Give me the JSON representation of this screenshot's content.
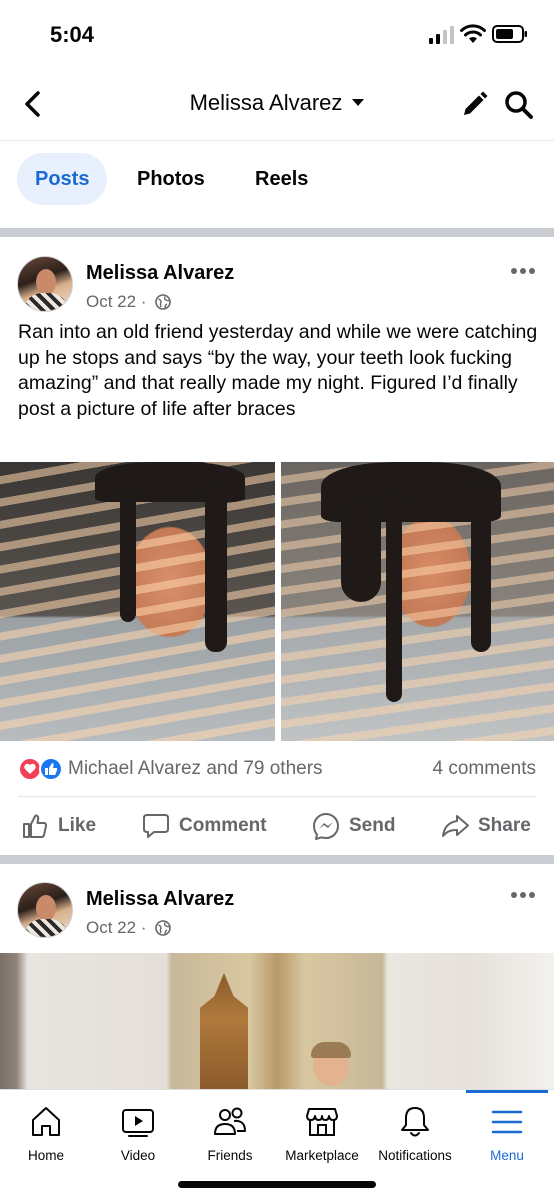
{
  "status_bar": {
    "time": "5:04"
  },
  "header": {
    "title": "Melissa Alvarez"
  },
  "tabs": [
    {
      "label": "Posts",
      "active": true
    },
    {
      "label": "Photos",
      "active": false
    },
    {
      "label": "Reels",
      "active": false
    }
  ],
  "posts": [
    {
      "author": "Melissa Alvarez",
      "date": "Oct 22",
      "separator": "·",
      "text": "Ran into an old friend yesterday and while we were catching up he stops and says “by the way, your teeth look fucking amazing” and that really made my night. Figured I’d finally post a picture of life after braces",
      "reactions_text": "Michael Alvarez and 79 others",
      "comments_text": "4 comments",
      "actions": [
        "Like",
        "Comment",
        "Send",
        "Share"
      ]
    },
    {
      "author": "Melissa Alvarez",
      "date": "Oct 22",
      "separator": "·"
    }
  ],
  "tab_bar": {
    "items": [
      {
        "label": "Home",
        "icon": "home-icon"
      },
      {
        "label": "Video",
        "icon": "video-icon"
      },
      {
        "label": "Friends",
        "icon": "friends-icon"
      },
      {
        "label": "Marketplace",
        "icon": "marketplace-icon"
      },
      {
        "label": "Notifications",
        "icon": "bell-icon"
      },
      {
        "label": "Menu",
        "icon": "menu-icon",
        "active": true
      }
    ]
  },
  "colors": {
    "accent": "#1b6ad4",
    "active_tab_bg": "#e7f0fc",
    "secondary_text": "#65676b",
    "like_blue": "#1877f2",
    "love_red": "#f33e58"
  }
}
